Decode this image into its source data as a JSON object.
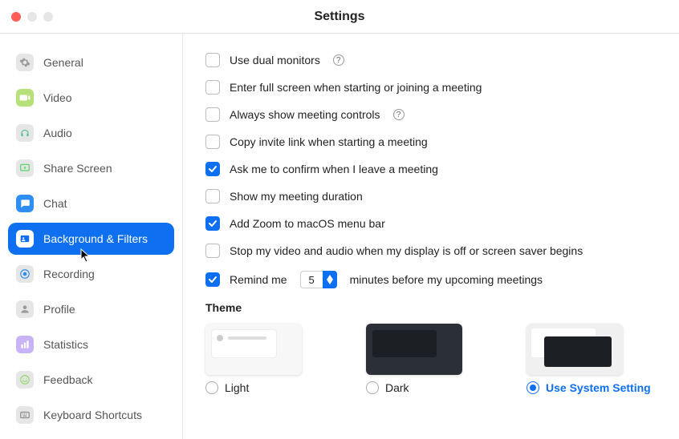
{
  "window": {
    "title": "Settings"
  },
  "sidebar": {
    "items": [
      {
        "id": "general",
        "label": "General",
        "icon": "gear-icon",
        "iconBg": "#e6e6e6",
        "iconFg": "#9a9a9a"
      },
      {
        "id": "video",
        "label": "Video",
        "icon": "video-icon",
        "iconBg": "#b7e07a",
        "iconFg": "#ffffff"
      },
      {
        "id": "audio",
        "label": "Audio",
        "icon": "headphones-icon",
        "iconBg": "#e6e6e6",
        "iconFg": "#56c596"
      },
      {
        "id": "share-screen",
        "label": "Share Screen",
        "icon": "share-screen-icon",
        "iconBg": "#e6e6e6",
        "iconFg": "#4cd35f"
      },
      {
        "id": "chat",
        "label": "Chat",
        "icon": "chat-icon",
        "iconBg": "#2f8ef4",
        "iconFg": "#ffffff"
      },
      {
        "id": "background-filters",
        "label": "Background & Filters",
        "icon": "person-card-icon",
        "iconBg": "#ffffff",
        "iconFg": "#0e6ff0",
        "active": true
      },
      {
        "id": "recording",
        "label": "Recording",
        "icon": "record-icon",
        "iconBg": "#e6e6e6",
        "iconFg": "#2f8ef4"
      },
      {
        "id": "profile",
        "label": "Profile",
        "icon": "profile-icon",
        "iconBg": "#e6e6e6",
        "iconFg": "#9a9a9a"
      },
      {
        "id": "statistics",
        "label": "Statistics",
        "icon": "stats-icon",
        "iconBg": "#c9b3f7",
        "iconFg": "#ffffff"
      },
      {
        "id": "feedback",
        "label": "Feedback",
        "icon": "smile-icon",
        "iconBg": "#e6e6e6",
        "iconFg": "#8fd96b"
      },
      {
        "id": "keyboard-shortcuts",
        "label": "Keyboard Shortcuts",
        "icon": "keyboard-icon",
        "iconBg": "#e6e6e6",
        "iconFg": "#8b8b8b"
      }
    ]
  },
  "options": [
    {
      "id": "dual-monitors",
      "label": "Use dual monitors",
      "checked": false,
      "help": true
    },
    {
      "id": "full-screen",
      "label": "Enter full screen when starting or joining a meeting",
      "checked": false
    },
    {
      "id": "always-controls",
      "label": "Always show meeting controls",
      "checked": false,
      "help": true
    },
    {
      "id": "copy-invite",
      "label": "Copy invite link when starting a meeting",
      "checked": false
    },
    {
      "id": "confirm-leave",
      "label": "Ask me to confirm when I leave a meeting",
      "checked": true
    },
    {
      "id": "show-duration",
      "label": "Show my meeting duration",
      "checked": false
    },
    {
      "id": "menu-bar",
      "label": "Add Zoom to macOS menu bar",
      "checked": true
    },
    {
      "id": "stop-on-sleep",
      "label": "Stop my video and audio when my display is off or screen saver begins",
      "checked": false
    }
  ],
  "remind": {
    "checked": true,
    "prefix": "Remind me",
    "value": "5",
    "suffix": "minutes before my upcoming meetings"
  },
  "theme": {
    "heading": "Theme",
    "options": [
      {
        "id": "light",
        "label": "Light",
        "selected": false
      },
      {
        "id": "dark",
        "label": "Dark",
        "selected": false
      },
      {
        "id": "system",
        "label": "Use System Setting",
        "selected": true
      }
    ]
  },
  "colors": {
    "accent": "#0e6ff0"
  }
}
